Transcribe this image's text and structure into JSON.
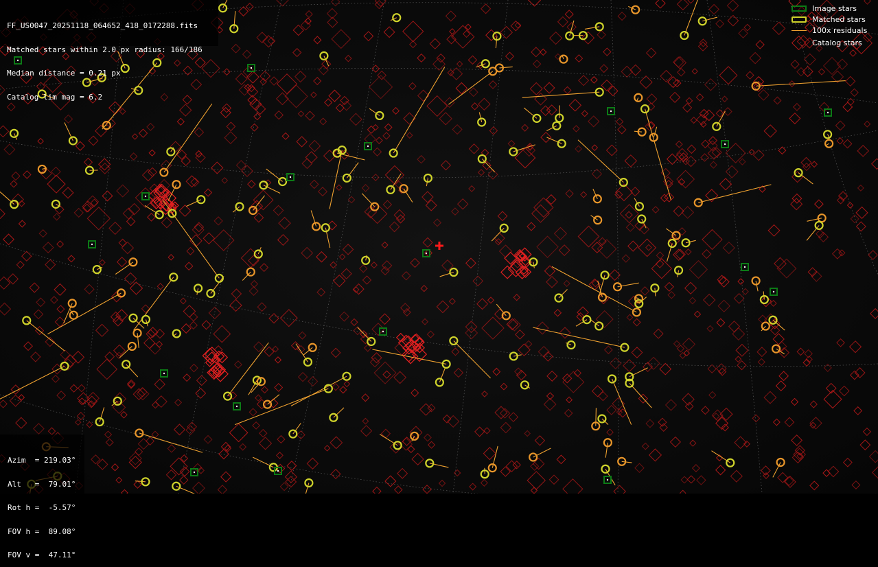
{
  "info": {
    "file": "FF_US0047_20251118_064652_418_0172288.fits",
    "matched": "Matched stars within 2.0 px radius: 166/186",
    "median": "Median distance = 0.21 px",
    "limmag": "Catalog lim mag = 6.2"
  },
  "pointing": {
    "azim": "Azim  = 219.03°",
    "alt": "Alt   =  79.01°",
    "roth": "Rot h =  -5.57°",
    "fovh": "FOV h =  89.08°",
    "fovv": "FOV v =  47.11°"
  },
  "legend": {
    "image_stars": "Image stars",
    "matched_stars": "Matched stars",
    "residuals": "100x residuals",
    "catalog_stars": "Catalog stars"
  },
  "colors": {
    "background": "#000000",
    "image_stars": "#0c7a16",
    "matched_stars": "#cfd32b",
    "residuals": "#f0a230",
    "catalog_stars": "#b01818",
    "center_marker": "#ff1a1a"
  }
}
